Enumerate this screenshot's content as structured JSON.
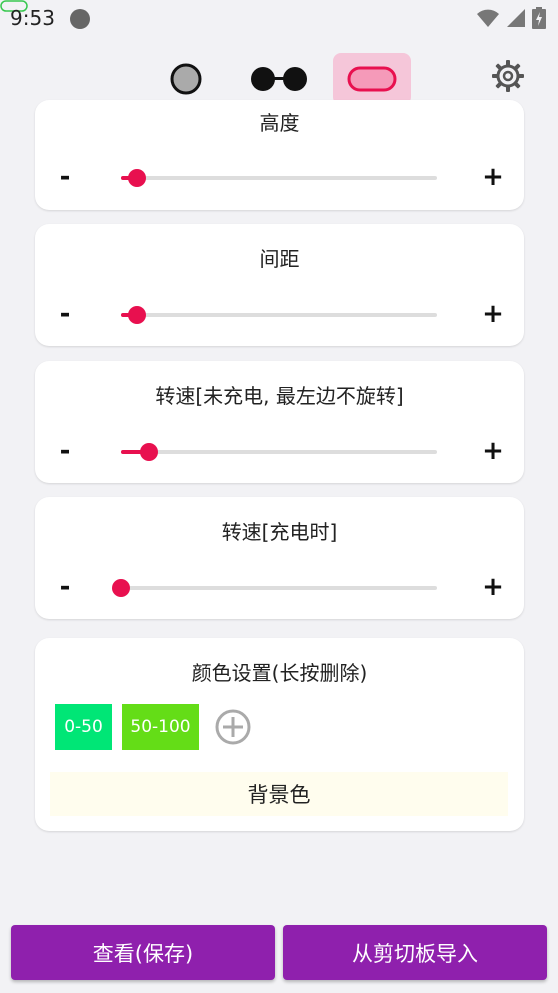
{
  "status": {
    "time": "9:53"
  },
  "modes": [
    {
      "name": "circle",
      "selected": false
    },
    {
      "name": "glasses",
      "selected": false
    },
    {
      "name": "pill",
      "selected": true
    }
  ],
  "colors": {
    "accent": "#e8104f",
    "primary": "#8f20ad",
    "chip0": "#00e676",
    "chip1": "#64dd17",
    "bg_color": "#fffdee"
  },
  "cards": {
    "height": {
      "title": "高度",
      "value": 0.05
    },
    "spacing": {
      "title": "间距",
      "value": 0.05
    },
    "speed_unplugged": {
      "title": "转速[未充电, 最左边不旋转]",
      "value": 0.09
    },
    "speed_charging": {
      "title": "转速[充电时]",
      "value": 0.0
    },
    "minus": "-",
    "plus": "+"
  },
  "color_settings": {
    "title": "颜色设置(长按删除)",
    "chips": [
      "0-50",
      "50-100"
    ],
    "background_label": "背景色"
  },
  "buttons": {
    "view_save": "查看(保存)",
    "import_clipboard": "从剪切板导入"
  }
}
